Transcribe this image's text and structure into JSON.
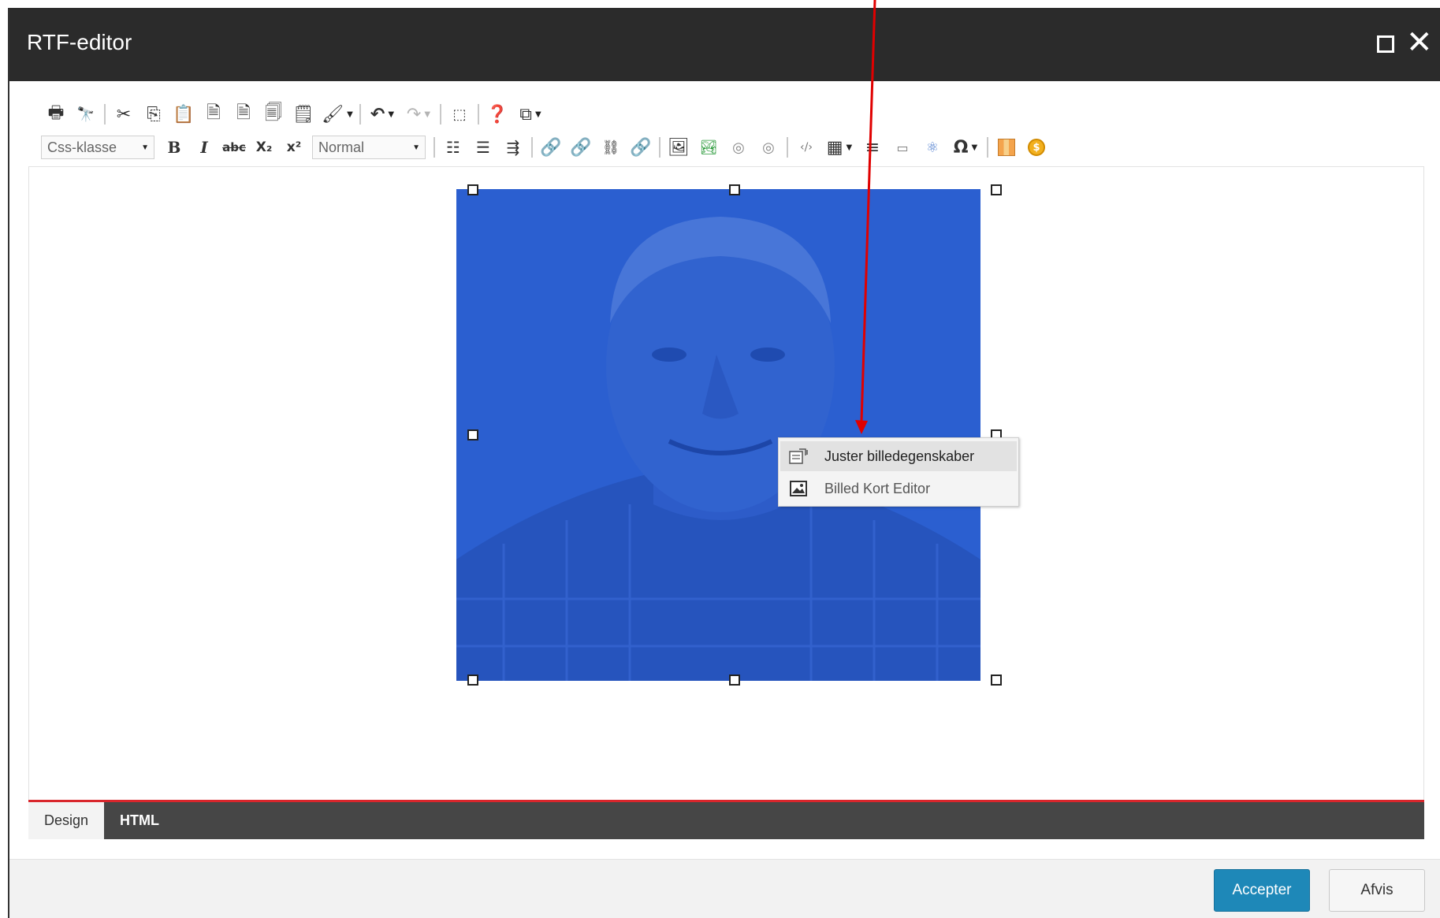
{
  "dialog": {
    "title": "RTF-editor",
    "maximize_icon": "maximize-icon",
    "close_icon": "close-icon"
  },
  "toolbar": {
    "row1": [
      {
        "icon": "print-icon",
        "glyph": "🖶"
      },
      {
        "icon": "find-icon",
        "glyph": "🔍"
      },
      {
        "sep": true
      },
      {
        "icon": "cut-icon",
        "glyph": "✂"
      },
      {
        "icon": "copy-icon",
        "glyph": "⎘"
      },
      {
        "icon": "paste-icon",
        "glyph": "📋"
      },
      {
        "icon": "paste-word-icon",
        "glyph": "🗎"
      },
      {
        "icon": "paste-word-clean-icon",
        "glyph": "🗎"
      },
      {
        "icon": "paste-text-icon",
        "glyph": "🗐"
      },
      {
        "icon": "paste-html-icon",
        "glyph": "🗒"
      },
      {
        "icon": "format-stripper-icon",
        "glyph": "🖌",
        "dropdown": true
      },
      {
        "sep": true
      },
      {
        "icon": "undo-icon",
        "glyph": "↶",
        "dropdown": true
      },
      {
        "icon": "redo-icon",
        "glyph": "↷",
        "dropdown": true,
        "disabled": true
      },
      {
        "sep": true
      },
      {
        "icon": "select-all-icon",
        "glyph": "⬚"
      },
      {
        "sep": true
      },
      {
        "icon": "help-icon",
        "glyph": "❓"
      },
      {
        "icon": "snippets-icon",
        "glyph": "⧉",
        "dropdown": true
      }
    ],
    "css_class_select": "Css-klasse",
    "paragraph_select": "Normal",
    "bold_label": "B",
    "italic_label": "I",
    "strike_label": "abc",
    "subscript_label": "X₂",
    "superscript_label": "x²"
  },
  "context_menu": {
    "items": [
      {
        "label": "Juster billedegenskaber",
        "icon": "image-properties-icon"
      },
      {
        "label": "Billed Kort Editor",
        "icon": "image-map-icon"
      }
    ]
  },
  "tabs": {
    "design": "Design",
    "html": "HTML"
  },
  "footer": {
    "accept": "Accepter",
    "reject": "Afvis"
  },
  "colors": {
    "titlebar": "#2b2b2b",
    "image_overlay": "#2b5fd0",
    "accent_red": "#d9262c",
    "accept_button": "#1e88b8",
    "arrow": "#e00000"
  }
}
